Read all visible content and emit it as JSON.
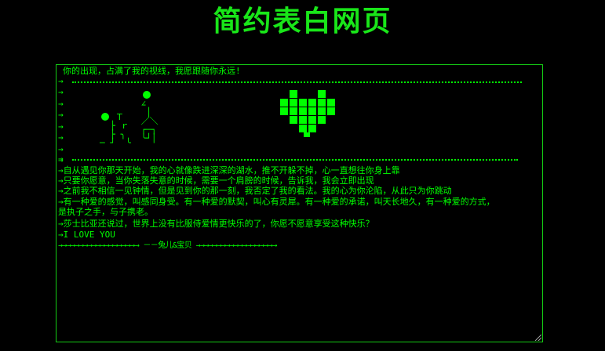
{
  "page": {
    "title": "简约表白网页"
  },
  "textbox": {
    "line1": "你的出现，占满了我的视线，我愿跟随你永远!",
    "art_arrow": "→",
    "arrow_rows": "→\n→\n→\n→\n→\n→\n→",
    "line_after_art": "→",
    "p1": "→自从遇见你那天开始，我的心就像跌进深深的湖水，推不开躲不掉，心一直想往你身上靠",
    "p2": "→只要你愿意，当你失落失意的时候，需要一个肩膀的时候，告诉我，我会立即出现",
    "p3": "→之前我不相信一见钟情，但是见到你的那一刻，我否定了我的看法。我的心为你沦陷，从此只为你跳动",
    "p4a": "→有一种爱的感觉，叫感同身受。有一种爱的默契，叫心有灵犀。有一种爱的承诺，叫天长地久，有一种爱的方式，",
    "p4b": "是执子之手，与子携老。",
    "p5": "→莎士比亚还说过，世界上没有比服侍爱情更快乐的了，你愿不愿意享受这种快乐？",
    "p6": "→I LOVE YOU",
    "sign": "→→→→→→→→→→→→→→→→→→→  －－兔儿&宝贝 →→→→→→→→→→→→→→→→→→→"
  },
  "colors": {
    "title": "#19e619",
    "text": "#00ff00",
    "border": "#14cc14",
    "background": "#000000"
  }
}
